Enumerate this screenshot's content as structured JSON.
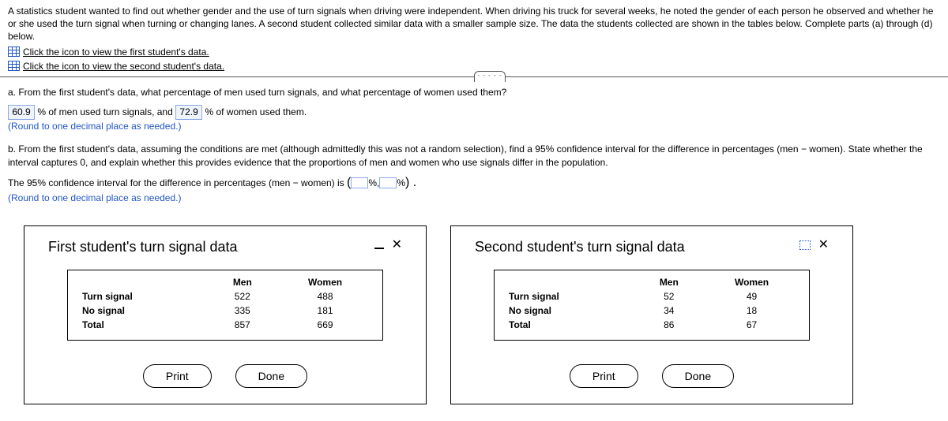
{
  "intro": "A statistics student wanted to find out whether gender and the use of turn signals when driving were independent. When driving his truck for several weeks, he noted the gender of each person he observed and whether he or she used the turn signal when turning or changing lanes. A second student collected similar data with a smaller sample size. The data the students collected are shown in the tables below. Complete parts (a) through (d) below.",
  "link1": "Click the icon to view the first student's data.",
  "link2": "Click the icon to view the second student's data.",
  "partA": {
    "prompt": "a. From the first student's data, what percentage of men used turn signals, and what percentage of women used them?",
    "ans_men": "60.9",
    "mid1": " % of men used turn signals, and ",
    "ans_women": "72.9",
    "mid2": " % of women used them.",
    "note": "(Round to one decimal place as needed.)"
  },
  "partB": {
    "prompt": "b. From the first student's data, assuming the conditions are met (although admittedly this was not a random selection), find a 95% confidence interval for the difference in percentages (men − women). State whether the interval captures 0, and explain whether this provides evidence that the proportions of men and women who use signals differ in the population.",
    "line_a": "The 95% confidence interval for the difference in percentages (men − women) is ",
    "paren_open": "(",
    "pct": "%,",
    "pct2": "%",
    "paren_close": ") .",
    "note": "(Round to one decimal place as needed.)"
  },
  "dialog1": {
    "title": "First student's turn signal data",
    "headers": [
      "",
      "Men",
      "Women"
    ],
    "rows": [
      {
        "label": "Turn signal",
        "men": "522",
        "women": "488"
      },
      {
        "label": "No signal",
        "men": "335",
        "women": "181"
      },
      {
        "label": "Total",
        "men": "857",
        "women": "669"
      }
    ],
    "print": "Print",
    "done": "Done"
  },
  "dialog2": {
    "title": "Second student's turn signal data",
    "headers": [
      "",
      "Men",
      "Women"
    ],
    "rows": [
      {
        "label": "Turn signal",
        "men": "52",
        "women": "49"
      },
      {
        "label": "No signal",
        "men": "34",
        "women": "18"
      },
      {
        "label": "Total",
        "men": "86",
        "women": "67"
      }
    ],
    "print": "Print",
    "done": "Done"
  },
  "chart_data": [
    {
      "type": "table",
      "title": "First student's turn signal data",
      "columns": [
        "",
        "Men",
        "Women"
      ],
      "rows": [
        [
          "Turn signal",
          522,
          488
        ],
        [
          "No signal",
          335,
          181
        ],
        [
          "Total",
          857,
          669
        ]
      ]
    },
    {
      "type": "table",
      "title": "Second student's turn signal data",
      "columns": [
        "",
        "Men",
        "Women"
      ],
      "rows": [
        [
          "Turn signal",
          52,
          49
        ],
        [
          "No signal",
          34,
          18
        ],
        [
          "Total",
          86,
          67
        ]
      ]
    }
  ]
}
